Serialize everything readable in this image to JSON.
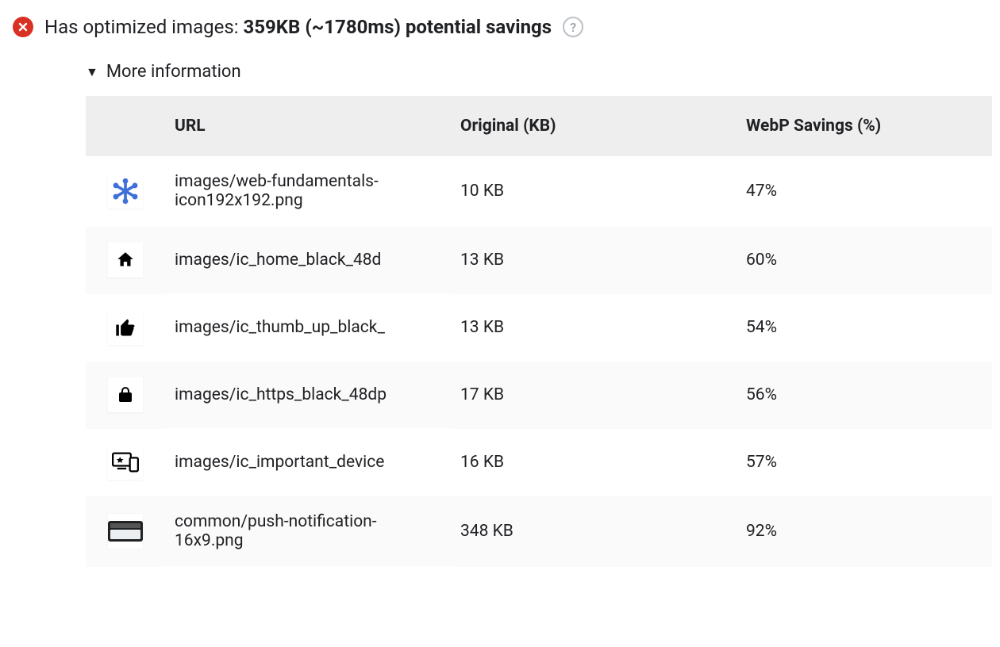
{
  "audit": {
    "title_prefix": "Has optimized images: ",
    "savings_text": "359KB (~1780ms) potential savings",
    "help_glyph": "?"
  },
  "details": {
    "toggle_label": "More information",
    "columns": {
      "url": "URL",
      "original": "Original (KB)",
      "savings": "WebP Savings (%)"
    },
    "rows": [
      {
        "icon": "asterisk",
        "url": "images/web-fundamentals-icon192x192.png",
        "wrap": true,
        "original": "10 KB",
        "savings": "47%"
      },
      {
        "icon": "home",
        "url": "images/ic_home_black_48d",
        "wrap": false,
        "original": "13 KB",
        "savings": "60%"
      },
      {
        "icon": "thumb",
        "url": "images/ic_thumb_up_black_",
        "wrap": false,
        "original": "13 KB",
        "savings": "54%"
      },
      {
        "icon": "lock",
        "url": "images/ic_https_black_48dp",
        "wrap": false,
        "original": "17 KB",
        "savings": "56%"
      },
      {
        "icon": "devices",
        "url": "images/ic_important_device",
        "wrap": false,
        "original": "16 KB",
        "savings": "57%"
      },
      {
        "icon": "push",
        "url": "common/push-notification-16x9.png",
        "wrap": true,
        "original": "348 KB",
        "savings": "92%"
      }
    ]
  }
}
